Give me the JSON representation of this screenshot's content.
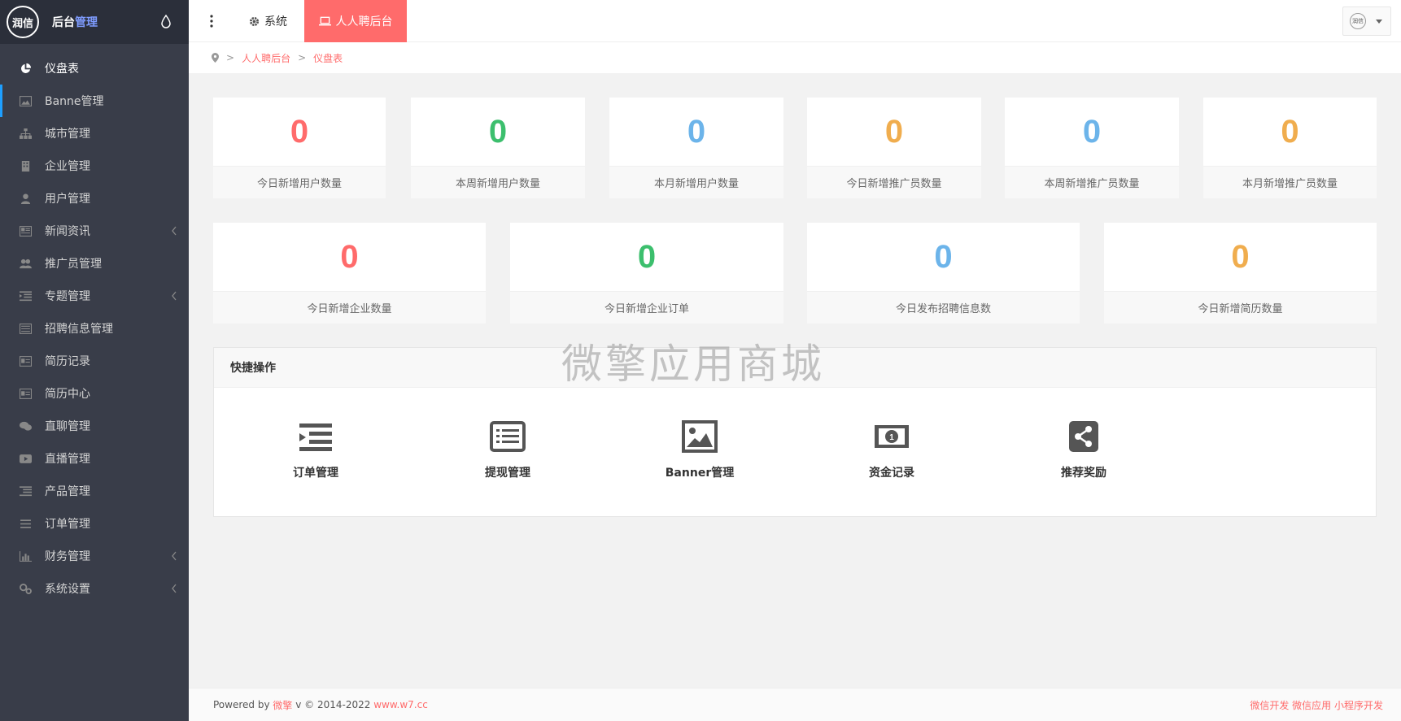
{
  "sidebar": {
    "logo_text": "润信",
    "title_part1": "后台",
    "title_part2": "管理",
    "items": [
      {
        "label": "仪盘表",
        "icon": "pie-chart-icon"
      },
      {
        "label": "Banne管理",
        "icon": "image-icon"
      },
      {
        "label": "城市管理",
        "icon": "sitemap-icon"
      },
      {
        "label": "企业管理",
        "icon": "building-icon"
      },
      {
        "label": "用户管理",
        "icon": "user-icon"
      },
      {
        "label": "新闻资讯",
        "icon": "newspaper-icon"
      },
      {
        "label": "推广员管理",
        "icon": "users-icon"
      },
      {
        "label": "专题管理",
        "icon": "list-indent-icon"
      },
      {
        "label": "招聘信息管理",
        "icon": "list-alt-icon"
      },
      {
        "label": "简历记录",
        "icon": "id-card-icon"
      },
      {
        "label": "简历中心",
        "icon": "id-card-icon"
      },
      {
        "label": "直聊管理",
        "icon": "chat-icon"
      },
      {
        "label": "直播管理",
        "icon": "play-icon"
      },
      {
        "label": "产品管理",
        "icon": "list-icon"
      },
      {
        "label": "订单管理",
        "icon": "bars-icon"
      },
      {
        "label": "财务管理",
        "icon": "bar-chart-icon"
      },
      {
        "label": "系统设置",
        "icon": "gears-icon"
      }
    ]
  },
  "topbar": {
    "tab_system": "系统",
    "tab_active": "人人聘后台",
    "avatar_text": "润信"
  },
  "breadcrumb": {
    "item1": "人人聘后台",
    "item2": "仪盘表"
  },
  "stats_row1": [
    {
      "value": "0",
      "label": "今日新增用户数量",
      "color": "#ff6b6b"
    },
    {
      "value": "0",
      "label": "本周新增用户数量",
      "color": "#3cbf6d"
    },
    {
      "value": "0",
      "label": "本月新增用户数量",
      "color": "#6cb4ea"
    },
    {
      "value": "0",
      "label": "今日新增推广员数量",
      "color": "#f0ad4e"
    },
    {
      "value": "0",
      "label": "本周新增推广员数量",
      "color": "#6cb4ea"
    },
    {
      "value": "0",
      "label": "本月新增推广员数量",
      "color": "#f0ad4e"
    }
  ],
  "stats_row2": [
    {
      "value": "0",
      "label": "今日新增企业数量",
      "color": "#ff6b6b"
    },
    {
      "value": "0",
      "label": "今日新增企业订单",
      "color": "#3cbf6d"
    },
    {
      "value": "0",
      "label": "今日发布招聘信息数",
      "color": "#6cb4ea"
    },
    {
      "value": "0",
      "label": "今日新增简历数量",
      "color": "#f0ad4e"
    }
  ],
  "quick": {
    "title": "快捷操作",
    "items": [
      {
        "label": "订单管理",
        "icon": "indent-icon"
      },
      {
        "label": "提现管理",
        "icon": "list-alt-icon"
      },
      {
        "label": "Banner管理",
        "icon": "picture-icon"
      },
      {
        "label": "资金记录",
        "icon": "money-icon"
      },
      {
        "label": "推荐奖励",
        "icon": "share-icon"
      }
    ]
  },
  "watermark": "微擎应用商城",
  "footer": {
    "powered": "Powered by",
    "brand": "微擎",
    "version": "v © 2014-2022",
    "site": "www.w7.cc",
    "right_links": "微信开发 微信应用 小程序开发"
  }
}
